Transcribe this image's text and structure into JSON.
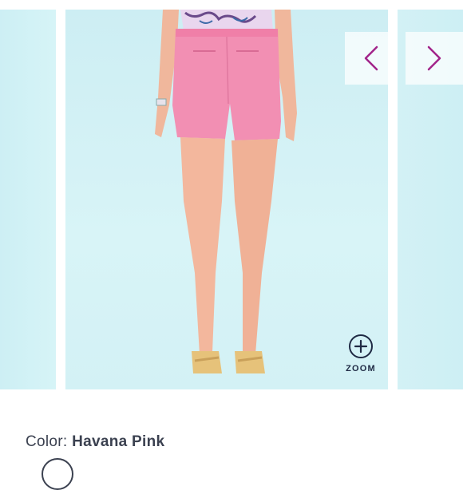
{
  "product_gallery": {
    "prev_icon": "chevron-left-icon",
    "next_icon": "chevron-right-icon",
    "zoom_label": "ZOOM",
    "zoom_icon": "plus-circle-icon",
    "accent_color": "#a2248a"
  },
  "product": {
    "color_label": "Color:",
    "color_value": "Havana Pink"
  }
}
